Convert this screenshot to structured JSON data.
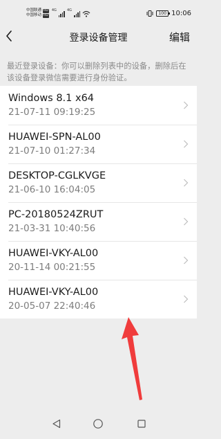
{
  "status_bar": {
    "carrier1": "中国联通",
    "carrier2": "中国移动",
    "hd_badge": "HD",
    "signal_tag": "4G",
    "battery_level": "100",
    "time": "10:06"
  },
  "nav": {
    "title": "登录设备管理",
    "edit_label": "编辑"
  },
  "description": "最近登录设备：你可以删除列表中的设备，删除后在该设备登录微信需要进行身份验证。",
  "devices": [
    {
      "name": "Windows 8.1 x64",
      "time": "21-07-11 09:19:25"
    },
    {
      "name": "HUAWEI-SPN-AL00",
      "time": "21-07-10 01:27:34"
    },
    {
      "name": "DESKTOP-CGLKVGE",
      "time": "21-06-10 16:04:05"
    },
    {
      "name": "PC-20180524ZRUT",
      "time": "21-03-31 10:40:56"
    },
    {
      "name": "HUAWEI-VKY-AL00",
      "time": "20-11-14 00:21:55"
    },
    {
      "name": "HUAWEI-VKY-AL00",
      "time": "20-05-07 22:40:46"
    }
  ],
  "colors": {
    "background": "#ededed",
    "list_background": "#ffffff",
    "primary_text": "#1a1a1a",
    "secondary_text": "#7d7d7d",
    "annotation_arrow": "#f03c3c"
  },
  "icons": {
    "back": "chevron-left-icon",
    "row": "chevron-right-icon",
    "sys_back": "triangle-back-icon",
    "sys_home": "circle-home-icon",
    "sys_recent": "square-recent-icon"
  }
}
